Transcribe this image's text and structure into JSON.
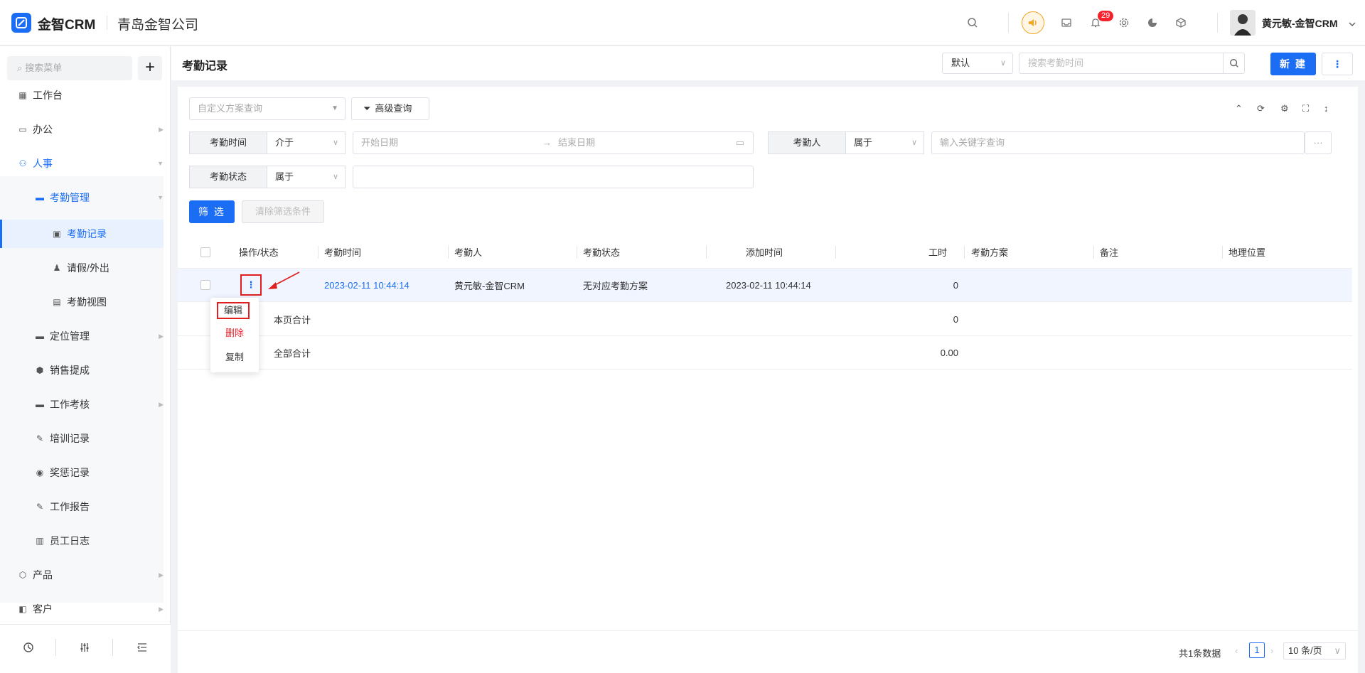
{
  "brand": {
    "logo_text": "金智CRM",
    "company": "青岛金智公司"
  },
  "topbar": {
    "notification_count": "29",
    "username": "黄元敏-金智CRM"
  },
  "sidebar": {
    "search_placeholder": "搜索菜单",
    "add_label": "+",
    "items": [
      {
        "label": "工作台"
      },
      {
        "label": "办公"
      },
      {
        "label": "人事"
      },
      {
        "label": "考勤管理"
      },
      {
        "label": "考勤记录"
      },
      {
        "label": "请假/外出"
      },
      {
        "label": "考勤视图"
      },
      {
        "label": "定位管理"
      },
      {
        "label": "销售提成"
      },
      {
        "label": "工作考核"
      },
      {
        "label": "培训记录"
      },
      {
        "label": "奖惩记录"
      },
      {
        "label": "工作报告"
      },
      {
        "label": "员工日志"
      },
      {
        "label": "产品"
      },
      {
        "label": "客户"
      }
    ]
  },
  "header": {
    "title": "考勤记录",
    "view_select": "默认",
    "search_placeholder": "搜索考勤时间",
    "new_button": "新 建",
    "more_button": "⋮"
  },
  "filters": {
    "scheme_placeholder": "自定义方案查询",
    "advanced_query": "高级查询",
    "time_label": "考勤时间",
    "time_op": "介于",
    "start_placeholder": "开始日期",
    "end_placeholder": "结束日期",
    "person_label": "考勤人",
    "person_op": "属于",
    "keyword_placeholder": "输入关键字查询",
    "status_label": "考勤状态",
    "status_op": "属于",
    "filter_button": "筛 选",
    "clear_button": "清除筛选条件"
  },
  "table": {
    "columns": [
      "操作/状态",
      "考勤时间",
      "考勤人",
      "考勤状态",
      "添加时间",
      "工时",
      "考勤方案",
      "备注",
      "地理位置"
    ],
    "rows": [
      {
        "time": "2023-02-11 10:44:14",
        "person": "黄元敏-金智CRM",
        "status": "无对应考勤方案",
        "added": "2023-02-11 10:44:14",
        "hours": "0"
      }
    ],
    "page_total_label": "本页合计",
    "page_total_hours": "0",
    "all_total_label": "全部合计",
    "all_total_hours": "0.00"
  },
  "row_menu": {
    "edit": "编辑",
    "delete": "删除",
    "copy": "复制"
  },
  "pagination": {
    "total": "共1条数据",
    "current_page": "1",
    "page_size": "10 条/页"
  },
  "colors": {
    "primary": "#1b6ef3",
    "danger": "#f5222d",
    "highlight": "#e02020"
  }
}
